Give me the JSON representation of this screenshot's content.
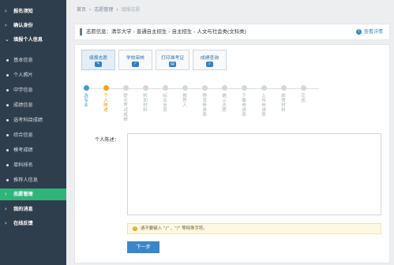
{
  "sidebar": {
    "items": [
      {
        "label": "报名须知",
        "type": "section"
      },
      {
        "label": "确认身份",
        "type": "section"
      },
      {
        "label": "填报个人信息",
        "type": "section"
      },
      {
        "label": "基本信息",
        "type": "sub"
      },
      {
        "label": "个人照片",
        "type": "sub"
      },
      {
        "label": "中学信息",
        "type": "sub"
      },
      {
        "label": "成绩信息",
        "type": "sub"
      },
      {
        "label": "选考科目成绩",
        "type": "sub"
      },
      {
        "label": "综合信息",
        "type": "sub"
      },
      {
        "label": "模考成绩",
        "type": "sub"
      },
      {
        "label": "单科排名",
        "type": "sub"
      },
      {
        "label": "推荐人信息",
        "type": "sub"
      },
      {
        "label": "志愿管理",
        "type": "section",
        "active": true
      },
      {
        "label": "我的消息",
        "type": "section"
      },
      {
        "label": "在线反馈",
        "type": "section"
      }
    ],
    "active_color": "#2fb47a"
  },
  "breadcrumb": {
    "items": [
      "首页",
      "志愿管理",
      "填报志愿"
    ],
    "separator": "›"
  },
  "info_bar": {
    "text": "志愿信息：清华大学 - 普通自主招生 - 自主招生 - 人文与社会类(文科类)",
    "detail_label": "查看详情",
    "detail_icon": "info-icon"
  },
  "tabs": [
    {
      "label": "填报志愿",
      "icon": "edit-icon",
      "active": true
    },
    {
      "label": "学校审核",
      "icon": "check-icon"
    },
    {
      "label": "打印准考证",
      "icon": "print-icon"
    },
    {
      "label": "成绩查询",
      "icon": "search-icon"
    }
  ],
  "steps": [
    {
      "label": "选专业",
      "state": "done"
    },
    {
      "label": "个人陈述",
      "state": "current"
    },
    {
      "label": "提交考试成绩",
      "state": "todo"
    },
    {
      "label": "附加材料",
      "state": "todo"
    },
    {
      "label": "综合信息",
      "state": "todo"
    },
    {
      "label": "推荐人",
      "state": "todo"
    },
    {
      "label": "预览申请表",
      "state": "todo"
    },
    {
      "label": "确认志愿",
      "state": "todo"
    },
    {
      "label": "下载申请表",
      "state": "todo"
    },
    {
      "label": "上传申请表",
      "state": "todo"
    },
    {
      "label": "邮寄材料",
      "state": "todo"
    },
    {
      "label": "完成",
      "state": "todo"
    }
  ],
  "form": {
    "field_label": "个人陈述：",
    "value": "",
    "tip": "请不要键入 “/” 、“/” 等特殊字符。",
    "submit_label": "下一步"
  },
  "colors": {
    "primary": "#3a86c8",
    "sidebar_bg": "#2f3e4c",
    "current_step": "#f0a30a"
  }
}
